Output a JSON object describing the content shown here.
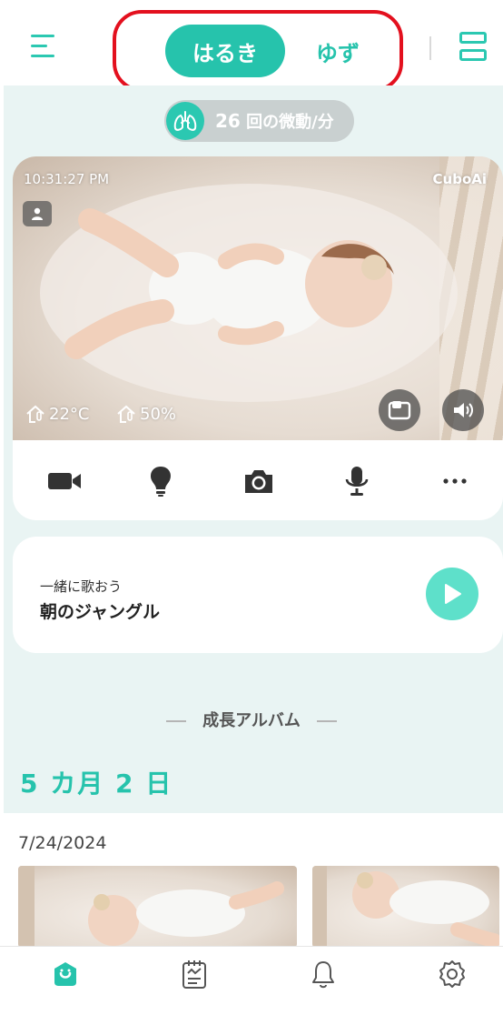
{
  "colors": {
    "accent": "#26c3ac",
    "highlight_border": "#e3101e",
    "background": "#e9f4f3"
  },
  "header": {
    "menu_icon": "menu-icon",
    "babies": [
      {
        "name": "はるき",
        "active": true
      },
      {
        "name": "ゆず",
        "active": false
      }
    ],
    "layout_icon": "split-view-icon"
  },
  "breathing": {
    "icon": "lungs-icon",
    "count": "26",
    "unit": "回の微動/分"
  },
  "camera": {
    "timestamp": "10:31:27 PM",
    "brand": "CuboAi",
    "temperature": "22°C",
    "humidity": "50%",
    "toolbar": [
      "video-camera-icon",
      "night-light-icon",
      "snapshot-camera-icon",
      "microphone-icon",
      "more-icon"
    ]
  },
  "song": {
    "subtitle": "一緒に歌おう",
    "title": "朝のジャングル"
  },
  "album": {
    "heading": "成長アルバム",
    "age": "5 カ月 2 日",
    "date": "7/24/2024"
  },
  "bottom_nav": [
    "home-icon",
    "journal-icon",
    "bell-icon",
    "settings-icon"
  ]
}
